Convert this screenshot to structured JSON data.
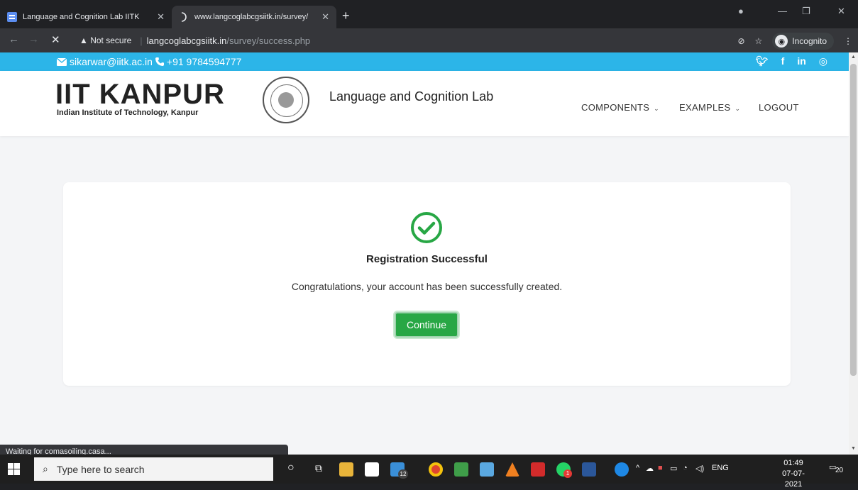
{
  "browser": {
    "tabs": [
      {
        "title": "Language and Cognition Lab IITK"
      },
      {
        "title": "www.langcoglabcgsiitk.in/survey/"
      }
    ],
    "new_tab": "+",
    "window_controls": {
      "minimize": "—",
      "restore": "❐",
      "close": "✕"
    },
    "nav": {
      "back": "←",
      "forward": "→",
      "stop": "✕"
    },
    "address": {
      "warning": "▲ Not secure",
      "host": "langcoglabcgsiitk.in",
      "path": "/survey/success.php"
    },
    "incognito_label": "Incognito",
    "status_text": "Waiting for comasoiling.casa..."
  },
  "site": {
    "contact": {
      "email": "sikarwar@iitk.ac.in",
      "phone": "+91 9784594777"
    },
    "social": [
      "twitter-icon",
      "facebook-icon",
      "linkedin-icon",
      "instagram-icon"
    ],
    "logo": {
      "main": "IIT KANPUR",
      "sub": "Indian Institute of Technology, Kanpur"
    },
    "brand": "Language and Cognition Lab",
    "nav": {
      "components": "COMPONENTS",
      "examples": "EXAMPLES",
      "logout": "LOGOUT"
    }
  },
  "card": {
    "title": "Registration Successful",
    "message": "Congratulations, your account has been successfully created.",
    "button": "Continue"
  },
  "colors": {
    "topbar": "#2cb5e8",
    "success": "#28a745"
  },
  "taskbar": {
    "search_placeholder": "Type here to search",
    "mail_badge": "12",
    "whatsapp_badge": "1",
    "language": "ENG",
    "time": "01:49",
    "date": "07-07-2021",
    "notifications": "20"
  }
}
